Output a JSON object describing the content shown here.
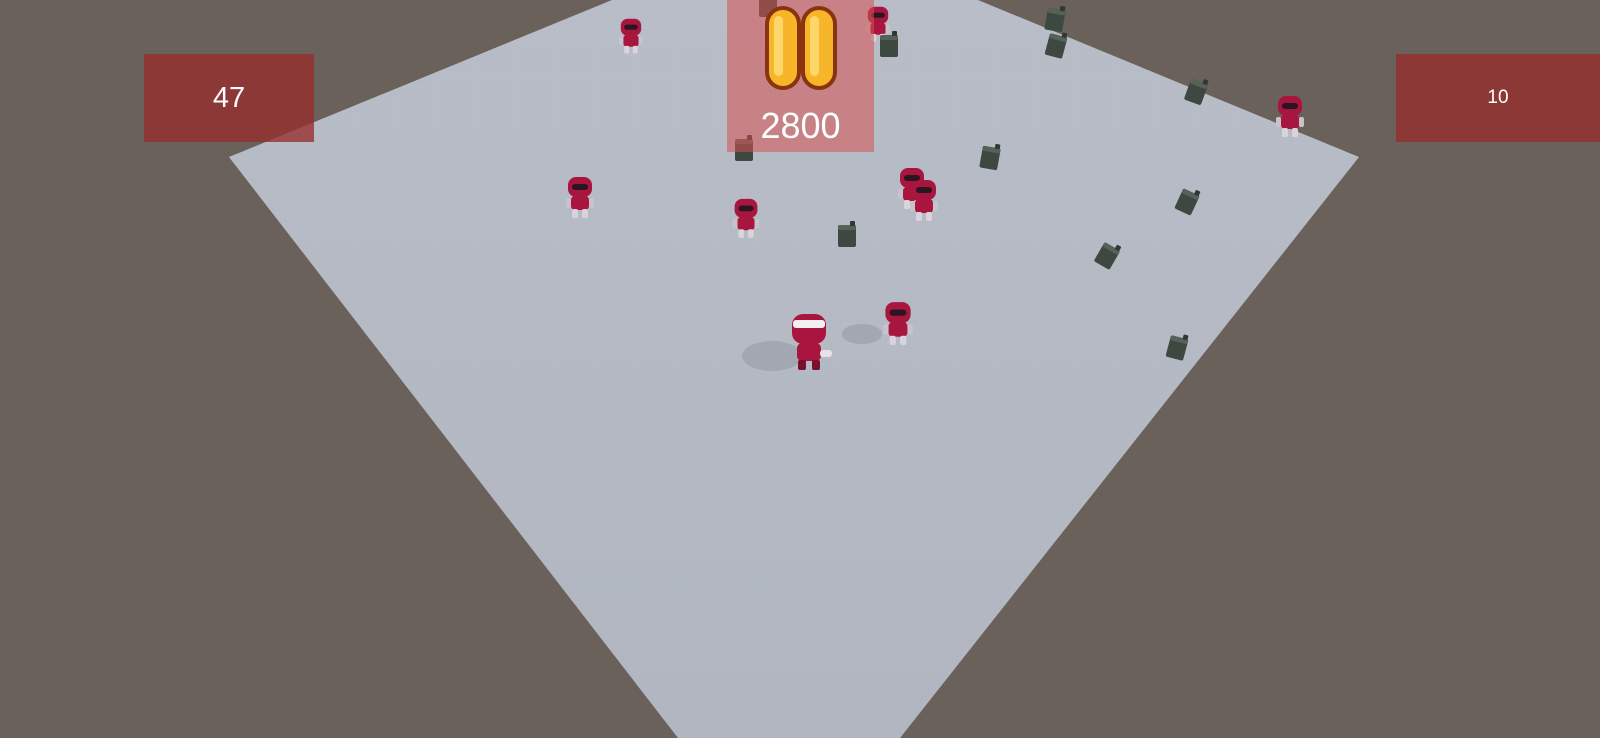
{
  "hud": {
    "left_value": "47",
    "right_value": "10",
    "score": "2800"
  },
  "icons": {
    "pause": "pause-icon"
  },
  "colors": {
    "ground": "#b6bbc4",
    "background": "#6a615b",
    "hud_panel": "#8f3434",
    "score_panel": "#d65252",
    "pause_fill": "#f7b52a",
    "pause_outline": "#8a3310",
    "robot": "#a8163f",
    "fuel_can": "#3d4840"
  }
}
